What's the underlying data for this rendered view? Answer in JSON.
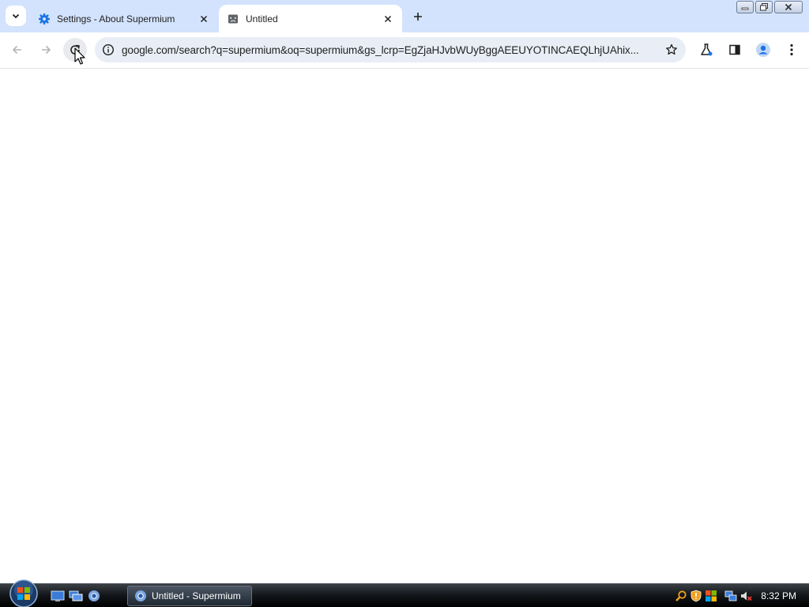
{
  "browser": {
    "tabs": [
      {
        "title": "Settings - About Supermium",
        "icon": "gear-icon",
        "active": false
      },
      {
        "title": "Untitled",
        "icon": "broken-page-icon",
        "active": true
      }
    ],
    "address_bar": {
      "url": "google.com/search?q=supermium&oq=supermium&gs_lcrp=EgZjaHJvbWUyBggAEEUYOTINCAEQLhjUAhix..."
    }
  },
  "taskbar": {
    "task_items": [
      {
        "label": "Untitled - Supermium",
        "icon": "supermium-icon"
      }
    ],
    "clock": "8:32 PM"
  },
  "colors": {
    "tabstrip_bg": "#d3e3fd",
    "omnibox_bg": "#e9eef6",
    "accent": "#1a73e8"
  }
}
